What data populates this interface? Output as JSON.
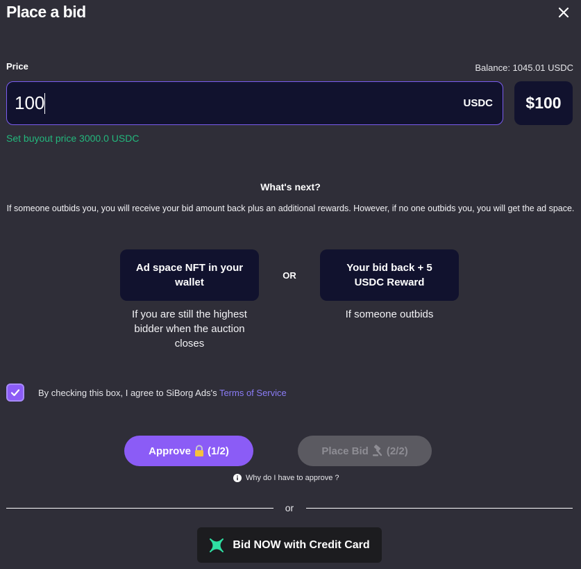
{
  "dialog": {
    "title": "Place a bid",
    "close_icon": "close-icon"
  },
  "price": {
    "label": "Price",
    "balance": "Balance: 1045.01 USDC",
    "value": "100",
    "currency": "USDC",
    "usd_value": "$100",
    "buyout_link": "Set buyout price 3000.0 USDC"
  },
  "whats_next": {
    "heading": "What's next?",
    "description": "If someone outbids you, you will receive your bid amount back plus an additional rewards. However, if no one outbids you, you will get the ad space.",
    "left_card": "Ad space NFT in your wallet",
    "left_caption": "If you are still the highest bidder when the auction closes",
    "or_label": "OR",
    "right_card": "Your bid back + 5 USDC Reward",
    "right_caption": "If someone outbids"
  },
  "terms": {
    "checked": true,
    "text": "By checking this box, I agree to SiBorg Ads's ",
    "link": "Terms of Service"
  },
  "actions": {
    "approve_label": "Approve",
    "approve_step": "(1/2)",
    "approve_icon": "lock-icon",
    "place_bid_label": "Place Bid",
    "place_bid_step": "(2/2)",
    "place_bid_icon": "hammer-icon",
    "why_label": "Why do I have to approve ?",
    "or_label": "or",
    "credit_card_label": "Bid NOW with Credit Card",
    "credit_card_icon": "crossmint-x-icon"
  },
  "colors": {
    "background": "#2f2e38",
    "card": "#11122e",
    "accent": "#8b5cf6",
    "success": "#23b87d",
    "disabled": "#5b5a61"
  }
}
